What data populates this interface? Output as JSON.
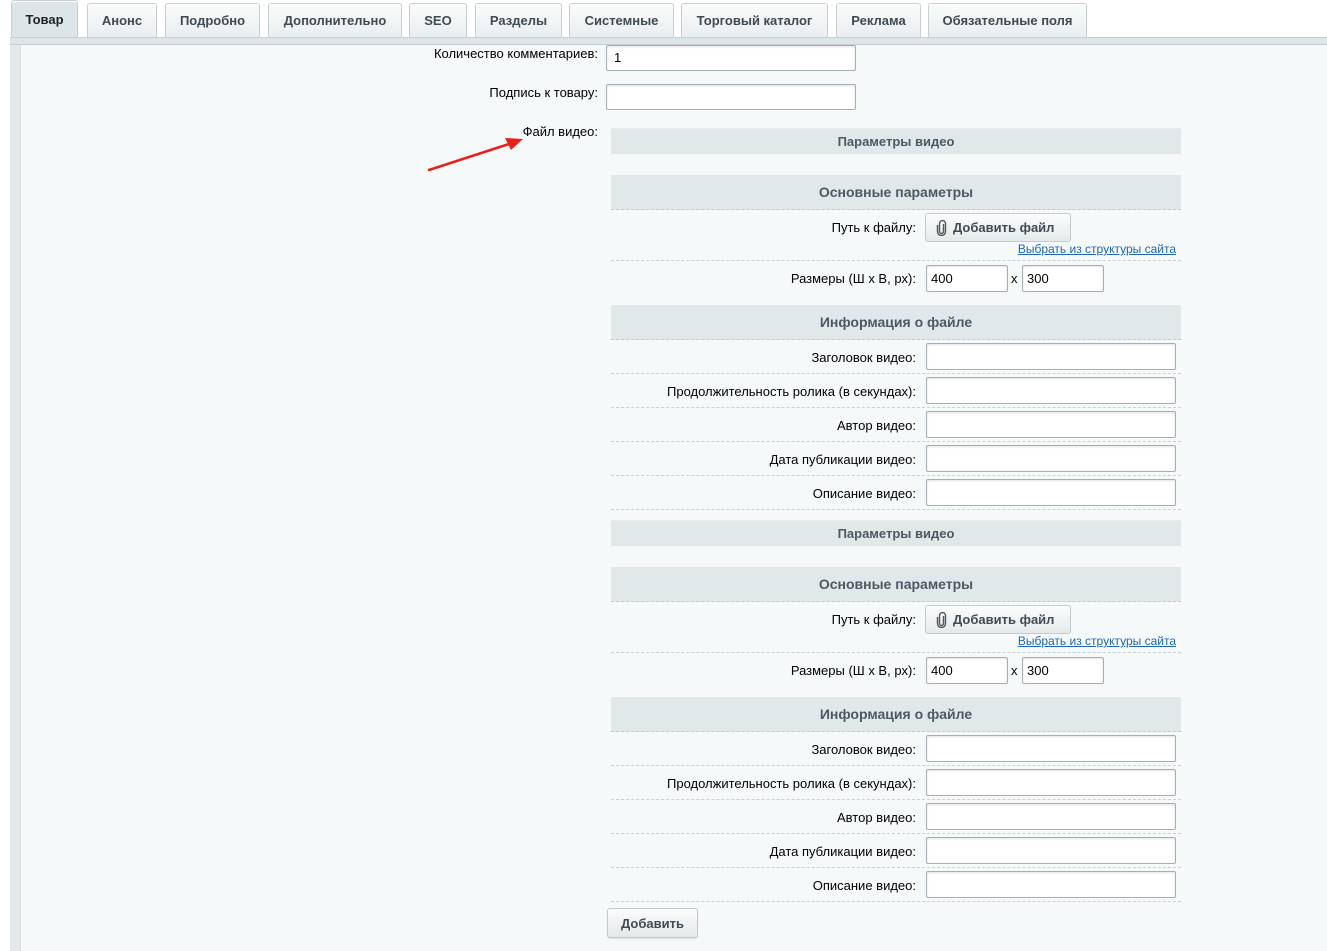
{
  "tabs": [
    {
      "label": "Товар",
      "active": true
    },
    {
      "label": "Анонс"
    },
    {
      "label": "Подробно"
    },
    {
      "label": "Дополнительно"
    },
    {
      "label": "SEO"
    },
    {
      "label": "Разделы"
    },
    {
      "label": "Системные"
    },
    {
      "label": "Торговый каталог"
    },
    {
      "label": "Реклама"
    },
    {
      "label": "Обязательные поля"
    }
  ],
  "fields": {
    "comments_count_label": "Количество комментариев:",
    "comments_count_value": "1",
    "caption_label": "Подпись к товару:",
    "caption_value": "",
    "video_file_label": "Файл видео:"
  },
  "video_blocks": [
    {
      "header": "Параметры видео",
      "main_section": "Основные параметры",
      "path_label": "Путь к файлу:",
      "add_file_button": "Добавить файл",
      "site_structure_link": "Выбрать из структуры сайта",
      "size_label": "Размеры (Ш x В, px):",
      "width": "400",
      "times": "x",
      "height": "300",
      "info_section": "Информация о файле",
      "title_label": "Заголовок видео:",
      "duration_label": "Продолжительность ролика (в секундах):",
      "author_label": "Автор видео:",
      "date_label": "Дата публикации видео:",
      "description_label": "Описание видео:"
    },
    {
      "header": "Параметры видео",
      "main_section": "Основные параметры",
      "path_label": "Путь к файлу:",
      "add_file_button": "Добавить файл",
      "site_structure_link": "Выбрать из структуры сайта",
      "size_label": "Размеры (Ш x В, px):",
      "width": "400",
      "times": "x",
      "height": "300",
      "info_section": "Информация о файле",
      "title_label": "Заголовок видео:",
      "duration_label": "Продолжительность ролика (в секундах):",
      "author_label": "Автор видео:",
      "date_label": "Дата публикации видео:",
      "description_label": "Описание видео:"
    }
  ],
  "add_button": "Добавить",
  "icons": {
    "paperclip": "paperclip-icon",
    "annotation_arrow": "red-arrow-icon"
  },
  "colors": {
    "annotation_arrow": "#e8201a",
    "link": "#2067b0"
  }
}
